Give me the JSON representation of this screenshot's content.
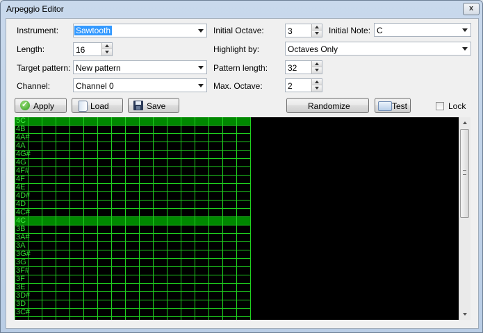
{
  "window": {
    "title": "Arpeggio Editor",
    "close_glyph": "x"
  },
  "form": {
    "instrument_label": "Instrument:",
    "instrument_value": "Sawtooth",
    "length_label": "Length:",
    "length_value": "16",
    "target_label": "Target pattern:",
    "target_value": "New pattern",
    "channel_label": "Channel:",
    "channel_value": "Channel 0",
    "initial_octave_label": "Initial Octave:",
    "initial_octave_value": "3",
    "initial_note_label": "Initial Note:",
    "initial_note_value": "C",
    "highlight_label": "Highlight by:",
    "highlight_value": "Octaves Only",
    "pattern_length_label": "Pattern length:",
    "pattern_length_value": "32",
    "max_octave_label": "Max. Octave:",
    "max_octave_value": "2"
  },
  "toolbar": {
    "apply_label": "Apply",
    "load_label": "Load",
    "save_label": "Save",
    "randomize_label": "Randomize",
    "test_label": "Test",
    "lock_label": "Lock"
  },
  "grid": {
    "notes": [
      "5C",
      "4B",
      "4A#",
      "4A",
      "4G#",
      "4G",
      "4F#",
      "4F",
      "4E",
      "4D#",
      "4D",
      "4C#",
      "4C",
      "3B",
      "3A#",
      "3A",
      "3G#",
      "3G",
      "3F#",
      "3F",
      "3E",
      "3D#",
      "3D",
      "3C#"
    ],
    "highlighted": [
      "5C",
      "4C"
    ],
    "columns": 17,
    "colors": {
      "line": "#1fd11f",
      "highlight": "#008800",
      "background": "#000000"
    }
  }
}
